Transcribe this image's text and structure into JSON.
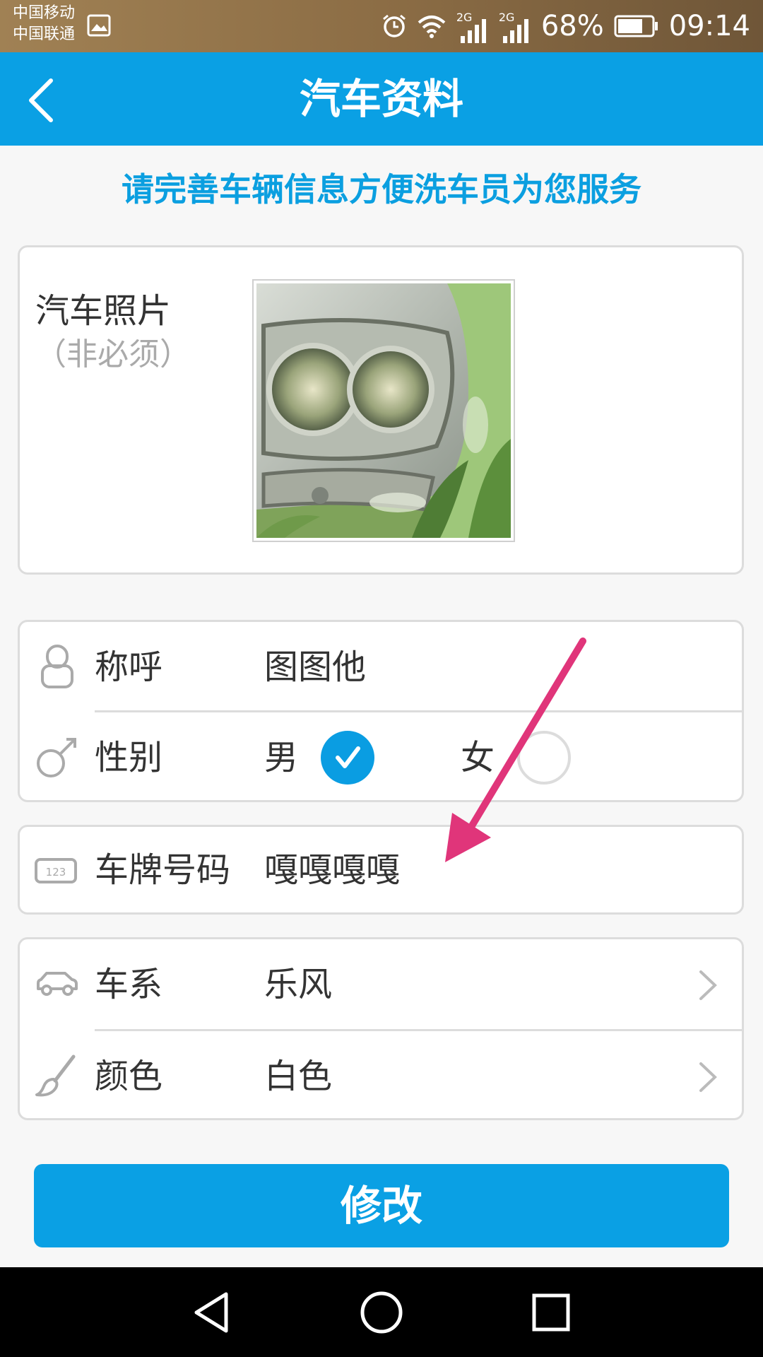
{
  "status_bar": {
    "carrier_1": "中国移动",
    "carrier_2": "中国联通",
    "network_1": "2G",
    "network_2": "2G",
    "battery": "68%",
    "time": "09:14"
  },
  "header": {
    "title": "汽车资料"
  },
  "hint": "请完善车辆信息方便洗车员为您服务",
  "photo": {
    "label": "汽车照片",
    "sublabel": "（非必须）"
  },
  "profile": {
    "nickname_label": "称呼",
    "nickname_value": "图图他",
    "gender_label": "性别",
    "gender_male": "男",
    "gender_female": "女",
    "gender_selected": "男"
  },
  "plate": {
    "label": "车牌号码",
    "value": "嘎嘎嘎嘎"
  },
  "vehicle": {
    "series_label": "车系",
    "series_value": "乐风",
    "color_label": "颜色",
    "color_value": "白色"
  },
  "submit_label": "修改",
  "colors": {
    "accent": "#0aa0e4",
    "annotation_arrow": "#e0357a"
  }
}
